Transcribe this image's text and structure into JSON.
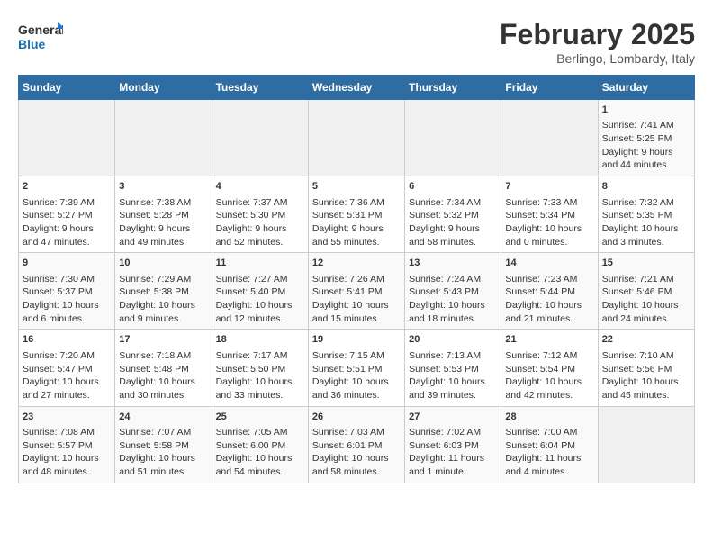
{
  "logo": {
    "line1": "General",
    "line2": "Blue"
  },
  "title": "February 2025",
  "subtitle": "Berlingo, Lombardy, Italy",
  "weekdays": [
    "Sunday",
    "Monday",
    "Tuesday",
    "Wednesday",
    "Thursday",
    "Friday",
    "Saturday"
  ],
  "weeks": [
    [
      {
        "day": "",
        "info": ""
      },
      {
        "day": "",
        "info": ""
      },
      {
        "day": "",
        "info": ""
      },
      {
        "day": "",
        "info": ""
      },
      {
        "day": "",
        "info": ""
      },
      {
        "day": "",
        "info": ""
      },
      {
        "day": "1",
        "info": "Sunrise: 7:41 AM\nSunset: 5:25 PM\nDaylight: 9 hours and 44 minutes."
      }
    ],
    [
      {
        "day": "2",
        "info": "Sunrise: 7:39 AM\nSunset: 5:27 PM\nDaylight: 9 hours and 47 minutes."
      },
      {
        "day": "3",
        "info": "Sunrise: 7:38 AM\nSunset: 5:28 PM\nDaylight: 9 hours and 49 minutes."
      },
      {
        "day": "4",
        "info": "Sunrise: 7:37 AM\nSunset: 5:30 PM\nDaylight: 9 hours and 52 minutes."
      },
      {
        "day": "5",
        "info": "Sunrise: 7:36 AM\nSunset: 5:31 PM\nDaylight: 9 hours and 55 minutes."
      },
      {
        "day": "6",
        "info": "Sunrise: 7:34 AM\nSunset: 5:32 PM\nDaylight: 9 hours and 58 minutes."
      },
      {
        "day": "7",
        "info": "Sunrise: 7:33 AM\nSunset: 5:34 PM\nDaylight: 10 hours and 0 minutes."
      },
      {
        "day": "8",
        "info": "Sunrise: 7:32 AM\nSunset: 5:35 PM\nDaylight: 10 hours and 3 minutes."
      }
    ],
    [
      {
        "day": "9",
        "info": "Sunrise: 7:30 AM\nSunset: 5:37 PM\nDaylight: 10 hours and 6 minutes."
      },
      {
        "day": "10",
        "info": "Sunrise: 7:29 AM\nSunset: 5:38 PM\nDaylight: 10 hours and 9 minutes."
      },
      {
        "day": "11",
        "info": "Sunrise: 7:27 AM\nSunset: 5:40 PM\nDaylight: 10 hours and 12 minutes."
      },
      {
        "day": "12",
        "info": "Sunrise: 7:26 AM\nSunset: 5:41 PM\nDaylight: 10 hours and 15 minutes."
      },
      {
        "day": "13",
        "info": "Sunrise: 7:24 AM\nSunset: 5:43 PM\nDaylight: 10 hours and 18 minutes."
      },
      {
        "day": "14",
        "info": "Sunrise: 7:23 AM\nSunset: 5:44 PM\nDaylight: 10 hours and 21 minutes."
      },
      {
        "day": "15",
        "info": "Sunrise: 7:21 AM\nSunset: 5:46 PM\nDaylight: 10 hours and 24 minutes."
      }
    ],
    [
      {
        "day": "16",
        "info": "Sunrise: 7:20 AM\nSunset: 5:47 PM\nDaylight: 10 hours and 27 minutes."
      },
      {
        "day": "17",
        "info": "Sunrise: 7:18 AM\nSunset: 5:48 PM\nDaylight: 10 hours and 30 minutes."
      },
      {
        "day": "18",
        "info": "Sunrise: 7:17 AM\nSunset: 5:50 PM\nDaylight: 10 hours and 33 minutes."
      },
      {
        "day": "19",
        "info": "Sunrise: 7:15 AM\nSunset: 5:51 PM\nDaylight: 10 hours and 36 minutes."
      },
      {
        "day": "20",
        "info": "Sunrise: 7:13 AM\nSunset: 5:53 PM\nDaylight: 10 hours and 39 minutes."
      },
      {
        "day": "21",
        "info": "Sunrise: 7:12 AM\nSunset: 5:54 PM\nDaylight: 10 hours and 42 minutes."
      },
      {
        "day": "22",
        "info": "Sunrise: 7:10 AM\nSunset: 5:56 PM\nDaylight: 10 hours and 45 minutes."
      }
    ],
    [
      {
        "day": "23",
        "info": "Sunrise: 7:08 AM\nSunset: 5:57 PM\nDaylight: 10 hours and 48 minutes."
      },
      {
        "day": "24",
        "info": "Sunrise: 7:07 AM\nSunset: 5:58 PM\nDaylight: 10 hours and 51 minutes."
      },
      {
        "day": "25",
        "info": "Sunrise: 7:05 AM\nSunset: 6:00 PM\nDaylight: 10 hours and 54 minutes."
      },
      {
        "day": "26",
        "info": "Sunrise: 7:03 AM\nSunset: 6:01 PM\nDaylight: 10 hours and 58 minutes."
      },
      {
        "day": "27",
        "info": "Sunrise: 7:02 AM\nSunset: 6:03 PM\nDaylight: 11 hours and 1 minute."
      },
      {
        "day": "28",
        "info": "Sunrise: 7:00 AM\nSunset: 6:04 PM\nDaylight: 11 hours and 4 minutes."
      },
      {
        "day": "",
        "info": ""
      }
    ]
  ]
}
